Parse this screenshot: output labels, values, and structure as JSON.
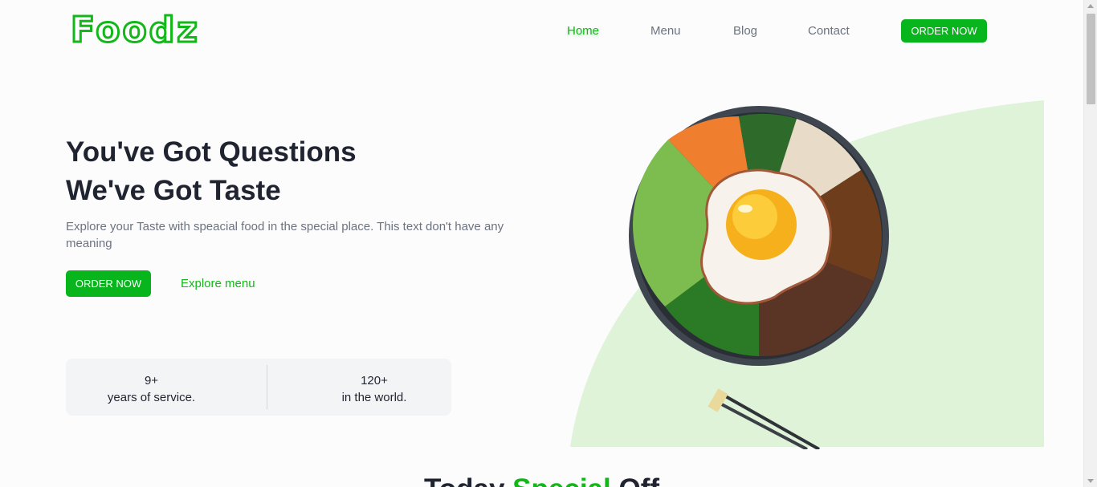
{
  "brand": {
    "logo_text": "Foodz"
  },
  "nav": {
    "links": [
      {
        "label": "Home",
        "active": true
      },
      {
        "label": "Menu",
        "active": false
      },
      {
        "label": "Blog",
        "active": false
      },
      {
        "label": "Contact",
        "active": false
      }
    ],
    "cta_label": "ORDER NOW"
  },
  "hero": {
    "title_line1": "You've Got Questions",
    "title_line2": "We've Got Taste",
    "description": "Explore your Taste with speacial food in the special place. This text don't have any meaning",
    "order_label": "ORDER NOW",
    "explore_label": "Explore menu",
    "stats": [
      {
        "value": "9+",
        "label": "years of service."
      },
      {
        "value": "120+",
        "label": "in the world."
      }
    ]
  },
  "section": {
    "title_start": "Today ",
    "title_accent": "Special",
    "title_end": " Off"
  },
  "colors": {
    "brand_green": "#11b817",
    "button_green": "#09b51c",
    "blob_green": "#dff3d9",
    "text_dark": "#1f2430",
    "text_muted": "#6b7280"
  },
  "icons": [
    "bibimbap-bowl-illustration",
    "chopsticks-icon"
  ]
}
